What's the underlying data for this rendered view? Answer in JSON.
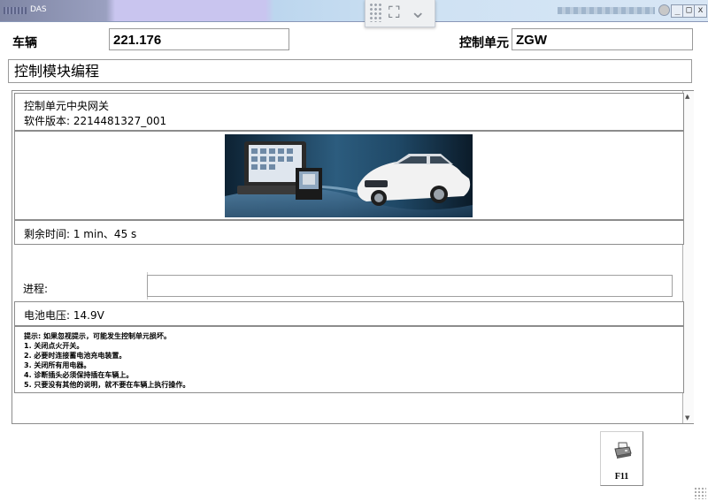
{
  "window": {
    "title": "DAS",
    "controls": {
      "minimize": "_",
      "maximize": "□",
      "close": "x",
      "help": ""
    }
  },
  "overlay_toolbar": {
    "icons": [
      "grip-icon",
      "expand-icon",
      "chevron-down-icon"
    ]
  },
  "header": {
    "vehicle_label": "车辆",
    "vehicle_value": "221.176",
    "control_unit_label": "控制单元",
    "control_unit_value": "ZGW"
  },
  "section_title": "控制模块编程",
  "panel": {
    "unit_line": "控制单元中央网关",
    "software_version": "软件版本: 2214481327_001",
    "remaining_time": "剩余时间: 1 min、45 s",
    "progress_label": "进程:",
    "progress_value": 0,
    "battery_voltage": "电池电压: 14.9V",
    "notes": [
      "提示:   如果忽视提示，可能发生控制单元损坏。",
      "1. 关闭点火开关。",
      "2. 必要时连接蓄电池充电装置。",
      "3. 关闭所有用电器。",
      "4. 诊断插头必须保持插在车辆上。",
      "5. 只要没有其他的说明，就不要在车辆上执行操作。"
    ]
  },
  "footer": {
    "f11_label": "F11",
    "f11_icon": "printer-icon"
  },
  "colors": {
    "titlebar": "#c9c5ef",
    "border": "#8c8c8c",
    "car": "#f2f2f2",
    "sky": "#1a3f5c"
  }
}
